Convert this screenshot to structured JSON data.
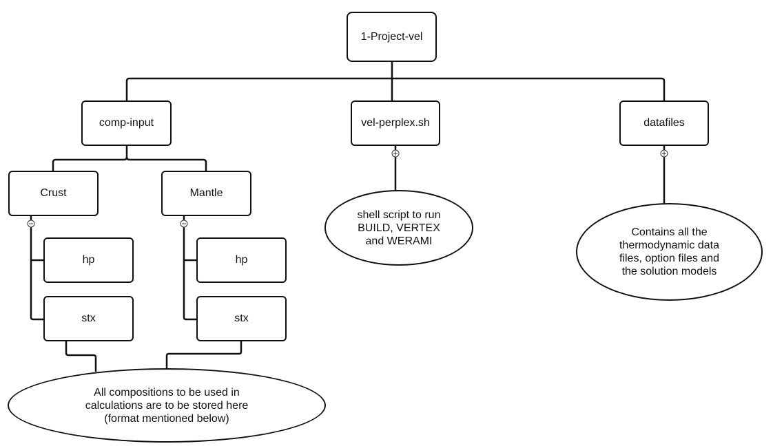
{
  "diagram": {
    "root": {
      "label": "1-Project-vel"
    },
    "children": [
      {
        "id": "comp-input",
        "label": "comp-input"
      },
      {
        "id": "vel-perplex",
        "label": "vel-perplex.sh"
      },
      {
        "id": "datafiles",
        "label": "datafiles"
      }
    ],
    "comp_input_children": [
      {
        "id": "crust",
        "label": "Crust",
        "sub": [
          "hp",
          "stx"
        ]
      },
      {
        "id": "mantle",
        "label": "Mantle",
        "sub": [
          "hp",
          "stx"
        ]
      }
    ],
    "notes": {
      "compositions": "All compositions to be used in\ncalculations are to be stored here\n(format mentioned below)",
      "shell_script": "shell script to run\nBUILD, VERTEX\nand WERAMI",
      "datafiles": "Contains all the\nthermodynamic data\nfiles, option files and\nthe solution models"
    },
    "markers": {
      "crust": "collapse-minus",
      "mantle": "collapse-minus",
      "vel_perplex": "expand-plus",
      "datafiles": "expand-plus"
    }
  }
}
